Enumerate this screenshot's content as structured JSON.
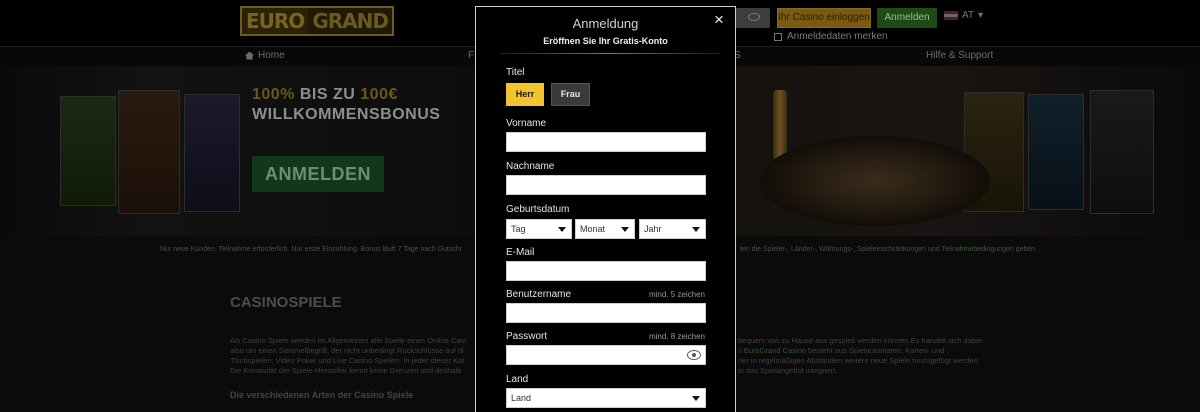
{
  "header": {
    "logo": {
      "part1": "EURO",
      "part2": "GRAND"
    },
    "forgot_label": "Ihr Casino einloggen",
    "login_label": "Anmelden",
    "language": "AT",
    "remember_label": "Anmeldedaten merken"
  },
  "nav": {
    "home": "Home",
    "item_f": "F",
    "item_s": "S",
    "help": "Hilfe & Support"
  },
  "hero": {
    "bonus_pct": "100%",
    "bonus_mid": "BIS ZU",
    "bonus_amount": "100€",
    "bonus_line2": "WILLKOMMENSBONUS",
    "cta_label": "ANMELDEN"
  },
  "disclaimer": {
    "left": "Nur neue Kunden. Teilnahme erforderlich. Nur erste Einzahlung. Bonus läuft 7 Tage nach Gutschr",
    "right_prefix": "ten die Spieler-, Länder-, Währungs-, Spieleinschränkungen und ",
    "right_link": "Teilnahmebedingungen",
    "right_suffix": " gelten."
  },
  "content": {
    "heading": "CASINOSPIELE",
    "left_lines": [
      "Als Casino Spiele werden im Allgemeinen alle Spiele eines Online Casi",
      "also um einen Sammelbegriff, der nicht unbedingt Rückschlüsse auf di",
      "Tischspielen, Video Poker und Live Casino Spielen. In jeder dieser Kat",
      "Die Kreativität der Spiele-Hersteller kennt keine Grenzen und deshalb"
    ],
    "right_lines": [
      "bequem von zu Hause aus gespielt werden können.Es handelt sich dabei",
      "s ",
      "ner in regelmäßigen Abständen weitere neue Spiele hinzugefügt werden.",
      "in das Spielangebot integriert."
    ],
    "right_link": "EuroGrand Casino",
    "right_line2_suffix": " besteht aus Spielautomaten, Karten- und",
    "subheading": "Die verschiedenen Arten der Casino Spiele"
  },
  "modal": {
    "title": "Anmeldung",
    "subtitle": "Eröffnen Sie Ihr Gratis-Konto",
    "close": "×",
    "titel_label": "Titel",
    "herr_label": "Herr",
    "frau_label": "Frau",
    "vorname_label": "Vorname",
    "vorname_value": "",
    "nachname_label": "Nachname",
    "nachname_value": "",
    "geburtsdatum_label": "Geburtsdatum",
    "tag": "Tag",
    "monat": "Monat",
    "jahr": "Jahr",
    "email_label": "E-Mail",
    "email_value": "",
    "benutzername_label": "Benutzername",
    "benutzername_hint": "mind. 5 zeichen",
    "benutzername_value": "",
    "passwort_label": "Passwort",
    "passwort_hint": "mind. 8 zeichen",
    "passwort_value": "",
    "land_label": "Land",
    "land_select": "Land"
  },
  "colors": {
    "accent_yellow": "#f2c230",
    "green_button": "#1e4a14",
    "modal_border": "#cfcfcf"
  },
  "icons": {
    "close": "close-icon",
    "eye": "eye-icon",
    "home": "home-icon",
    "caret": "chevron-down-icon"
  }
}
